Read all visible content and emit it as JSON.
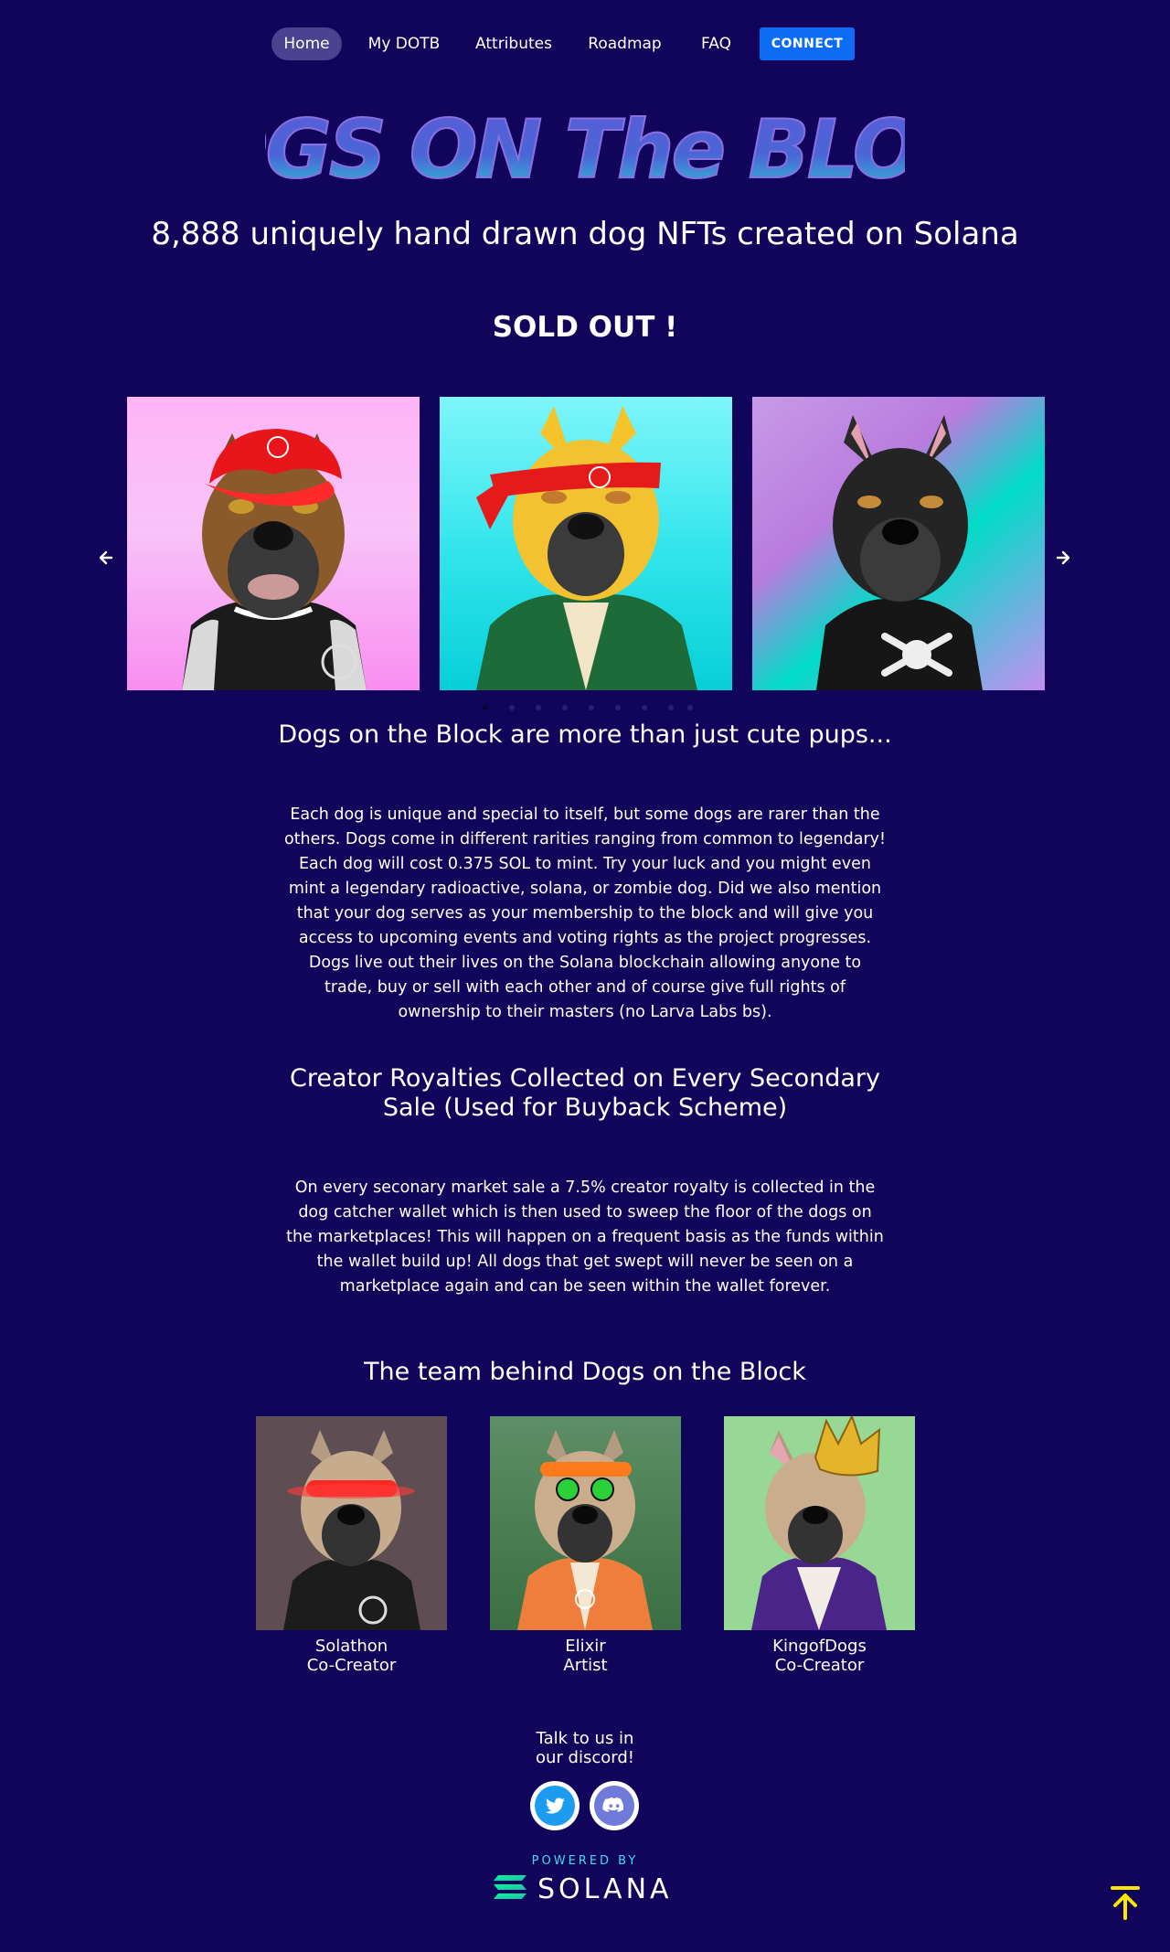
{
  "nav": {
    "home": "Home",
    "my_dotb": "My DOTB",
    "attributes": "Attributes",
    "roadmap": "Roadmap",
    "faq": "FAQ",
    "connect": "CONNECT"
  },
  "hero": {
    "logo_text": "DOGS ON The BLOCK",
    "tagline": "8,888 uniquely hand drawn dog NFTs created on Solana",
    "status": "SOLD OUT !"
  },
  "carousel": {
    "prev_icon": "arrow-left-icon",
    "next_icon": "arrow-right-icon",
    "dot_count": 9,
    "active_dot": 0
  },
  "about": {
    "heading": "Dogs on the Block are more than just cute pups...",
    "text": "Each dog is unique and special to itself, but some dogs are rarer than the others. Dogs come in different rarities ranging from common to legendary! Each dog will cost 0.375 SOL to mint. Try your luck and you might even mint a legendary radioactive, solana, or zombie dog. Did we also mention that your dog serves as your membership to the block and will give you access to upcoming events and voting rights as the project progresses. Dogs live out their lives on the Solana blockchain allowing anyone to trade, buy or sell with each other and of course give full rights of ownership to their masters (no Larva Labs bs)."
  },
  "royalties": {
    "heading_line1": "Creator Royalties Collected on Every Secondary",
    "heading_line2": "Sale (Used for Buyback Scheme)",
    "text": "On every seconary market sale a 7.5% creator royalty is collected in the dog catcher wallet which is then used to sweep the floor of the dogs on the marketplaces! This will happen on a frequent basis as the funds within the wallet build up! All dogs that get swept will never be seen on a marketplace again and can be seen within the wallet forever."
  },
  "team": {
    "heading": "The team behind Dogs on the Block",
    "members": [
      {
        "name": "Solathon",
        "role": "Co-Creator"
      },
      {
        "name": "Elixir",
        "role": "Artist"
      },
      {
        "name": "KingofDogs",
        "role": "Co-Creator"
      }
    ]
  },
  "footer": {
    "talk_line1": "Talk to us in",
    "talk_line2": "our discord!",
    "twitter_icon": "twitter-icon",
    "discord_icon": "discord-icon",
    "powered_by": "POWERED BY",
    "solana": "SOLANA",
    "back_to_top_icon": "arrow-up-to-top-icon"
  },
  "colors": {
    "background": "#10055a",
    "connect_button": "#0d6cf4",
    "home_pill": "#4c4390",
    "back_to_top": "#ffe600",
    "powered_by": "#46d9f0"
  }
}
